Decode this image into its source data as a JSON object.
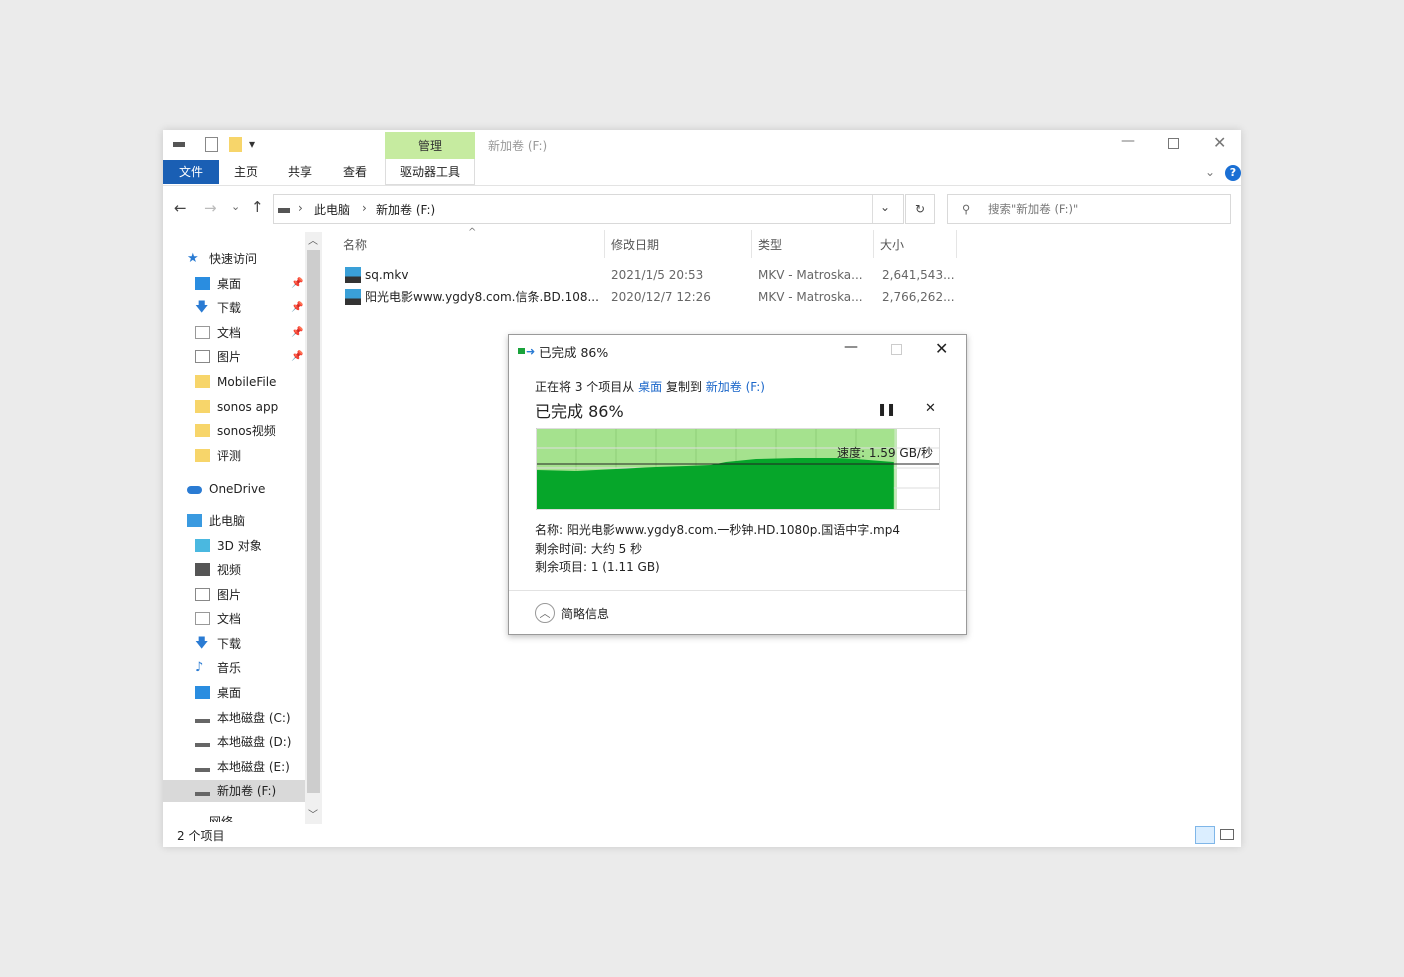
{
  "window": {
    "title": "新加卷 (F:)",
    "ribbon_context_group": "管理",
    "ribbon_context_tab": "驱动器工具",
    "tabs": [
      "文件",
      "主页",
      "共享",
      "查看"
    ],
    "help": "?"
  },
  "address": {
    "crumbs": [
      "此电脑",
      "新加卷 (F:)"
    ]
  },
  "search": {
    "placeholder": "搜索\"新加卷 (F:)\""
  },
  "columns": [
    "名称",
    "修改日期",
    "类型",
    "大小"
  ],
  "files": [
    {
      "name": "sq.mkv",
      "date": "2021/1/5 20:53",
      "type": "MKV - Matroska...",
      "size": "2,641,543..."
    },
    {
      "name": "阳光电影www.ygdy8.com.信条.BD.108...",
      "date": "2020/12/7 12:26",
      "type": "MKV - Matroska...",
      "size": "2,766,262..."
    }
  ],
  "sidebar": [
    {
      "label": "快速访问",
      "icon": "star-icon",
      "level": 0
    },
    {
      "label": "桌面",
      "icon": "desktop-icon",
      "level": 1,
      "pinned": true
    },
    {
      "label": "下载",
      "icon": "download-icon",
      "level": 1,
      "pinned": true
    },
    {
      "label": "文档",
      "icon": "document-icon",
      "level": 1,
      "pinned": true
    },
    {
      "label": "图片",
      "icon": "pictures-icon",
      "level": 1,
      "pinned": true
    },
    {
      "label": "MobileFile",
      "icon": "folder-icon",
      "level": 1
    },
    {
      "label": "sonos app",
      "icon": "folder-icon",
      "level": 1
    },
    {
      "label": "sonos视频",
      "icon": "folder-icon",
      "level": 1
    },
    {
      "label": "评测",
      "icon": "folder-icon",
      "level": 1
    },
    {
      "label": "OneDrive",
      "icon": "cloud-icon",
      "level": 0
    },
    {
      "label": "此电脑",
      "icon": "computer-icon",
      "level": 0
    },
    {
      "label": "3D 对象",
      "icon": "3d-objects-icon",
      "level": 1
    },
    {
      "label": "视频",
      "icon": "video-icon",
      "level": 1
    },
    {
      "label": "图片",
      "icon": "pictures-icon",
      "level": 1
    },
    {
      "label": "文档",
      "icon": "document-icon",
      "level": 1
    },
    {
      "label": "下载",
      "icon": "download-icon",
      "level": 1
    },
    {
      "label": "音乐",
      "icon": "music-icon",
      "level": 1
    },
    {
      "label": "桌面",
      "icon": "desktop-icon",
      "level": 1
    },
    {
      "label": "本地磁盘 (C:)",
      "icon": "drive-icon",
      "level": 1
    },
    {
      "label": "本地磁盘 (D:)",
      "icon": "drive-icon",
      "level": 1
    },
    {
      "label": "本地磁盘 (E:)",
      "icon": "drive-icon",
      "level": 1
    },
    {
      "label": "新加卷 (F:)",
      "icon": "drive-icon",
      "level": 1,
      "selected": true
    },
    {
      "label": "网络",
      "icon": "network-icon",
      "level": 0
    }
  ],
  "status": {
    "count": "2 个项目"
  },
  "dialog": {
    "title": "已完成 86%",
    "desc_prefix": "正在将 3 个项目从",
    "source": "桌面",
    "desc_mid": "复制到",
    "dest": "新加卷 (F:)",
    "progress_label": "已完成 86%",
    "progress_percent": 86,
    "speed": "速度: 1.59 GB/秒",
    "name": "名称: 阳光电影www.ygdy8.com.一秒钟.HD.1080p.国语中字.mp4",
    "time_left": "剩余时间: 大约 5 秒",
    "items_left": "剩余项目: 1 (1.11 GB)",
    "details_toggle": "简略信息",
    "colors": {
      "fill": "#06a62a",
      "background": "#a5e28e"
    }
  }
}
